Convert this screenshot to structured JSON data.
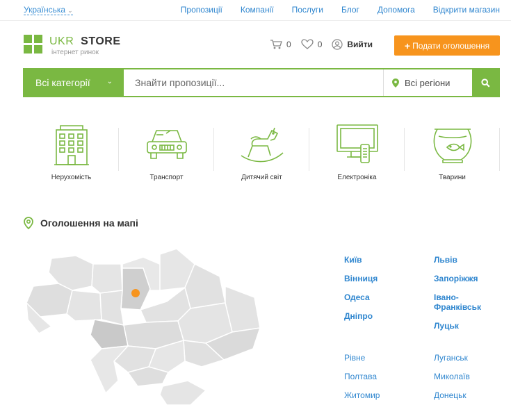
{
  "topbar": {
    "language": "Українська",
    "nav": [
      "Пропозиції",
      "Компанії",
      "Послуги",
      "Блог",
      "Допомога",
      "Відкрити магазин"
    ]
  },
  "header": {
    "logo_ukr": "UKR",
    "logo_store": "STORE",
    "logo_sub": "інтернет ринок",
    "cart_count": "0",
    "favorites_count": "0",
    "login": "Вийти",
    "post_button": "Подати оголошення"
  },
  "search": {
    "category": "Всі категорії",
    "placeholder": "Знайти пропозиції...",
    "region": "Всі регіони"
  },
  "categories": [
    {
      "label": "Нерухомість",
      "icon": "building-icon"
    },
    {
      "label": "Транспорт",
      "icon": "car-icon"
    },
    {
      "label": "Дитячий світ",
      "icon": "rocking-horse-icon"
    },
    {
      "label": "Електроніка",
      "icon": "tv-icon"
    },
    {
      "label": "Тварини",
      "icon": "aquarium-icon"
    }
  ],
  "map_section": {
    "title": "Оголошення на мапі",
    "cities_bold_left": [
      "Київ",
      "Вінниця",
      "Одеса",
      "Дніпро"
    ],
    "cities_bold_right": [
      "Львів",
      "Запоріжжя",
      "Івано-Франківськ",
      "Луцьк"
    ],
    "cities_left": [
      "Рівне",
      "Полтава",
      "Житомир"
    ],
    "cities_right": [
      "Луганськ",
      "Миколаїв",
      "Донецьк"
    ]
  },
  "colors": {
    "brand_green": "#7ab842",
    "accent_orange": "#f7941d",
    "link_blue": "#2f86cf"
  }
}
